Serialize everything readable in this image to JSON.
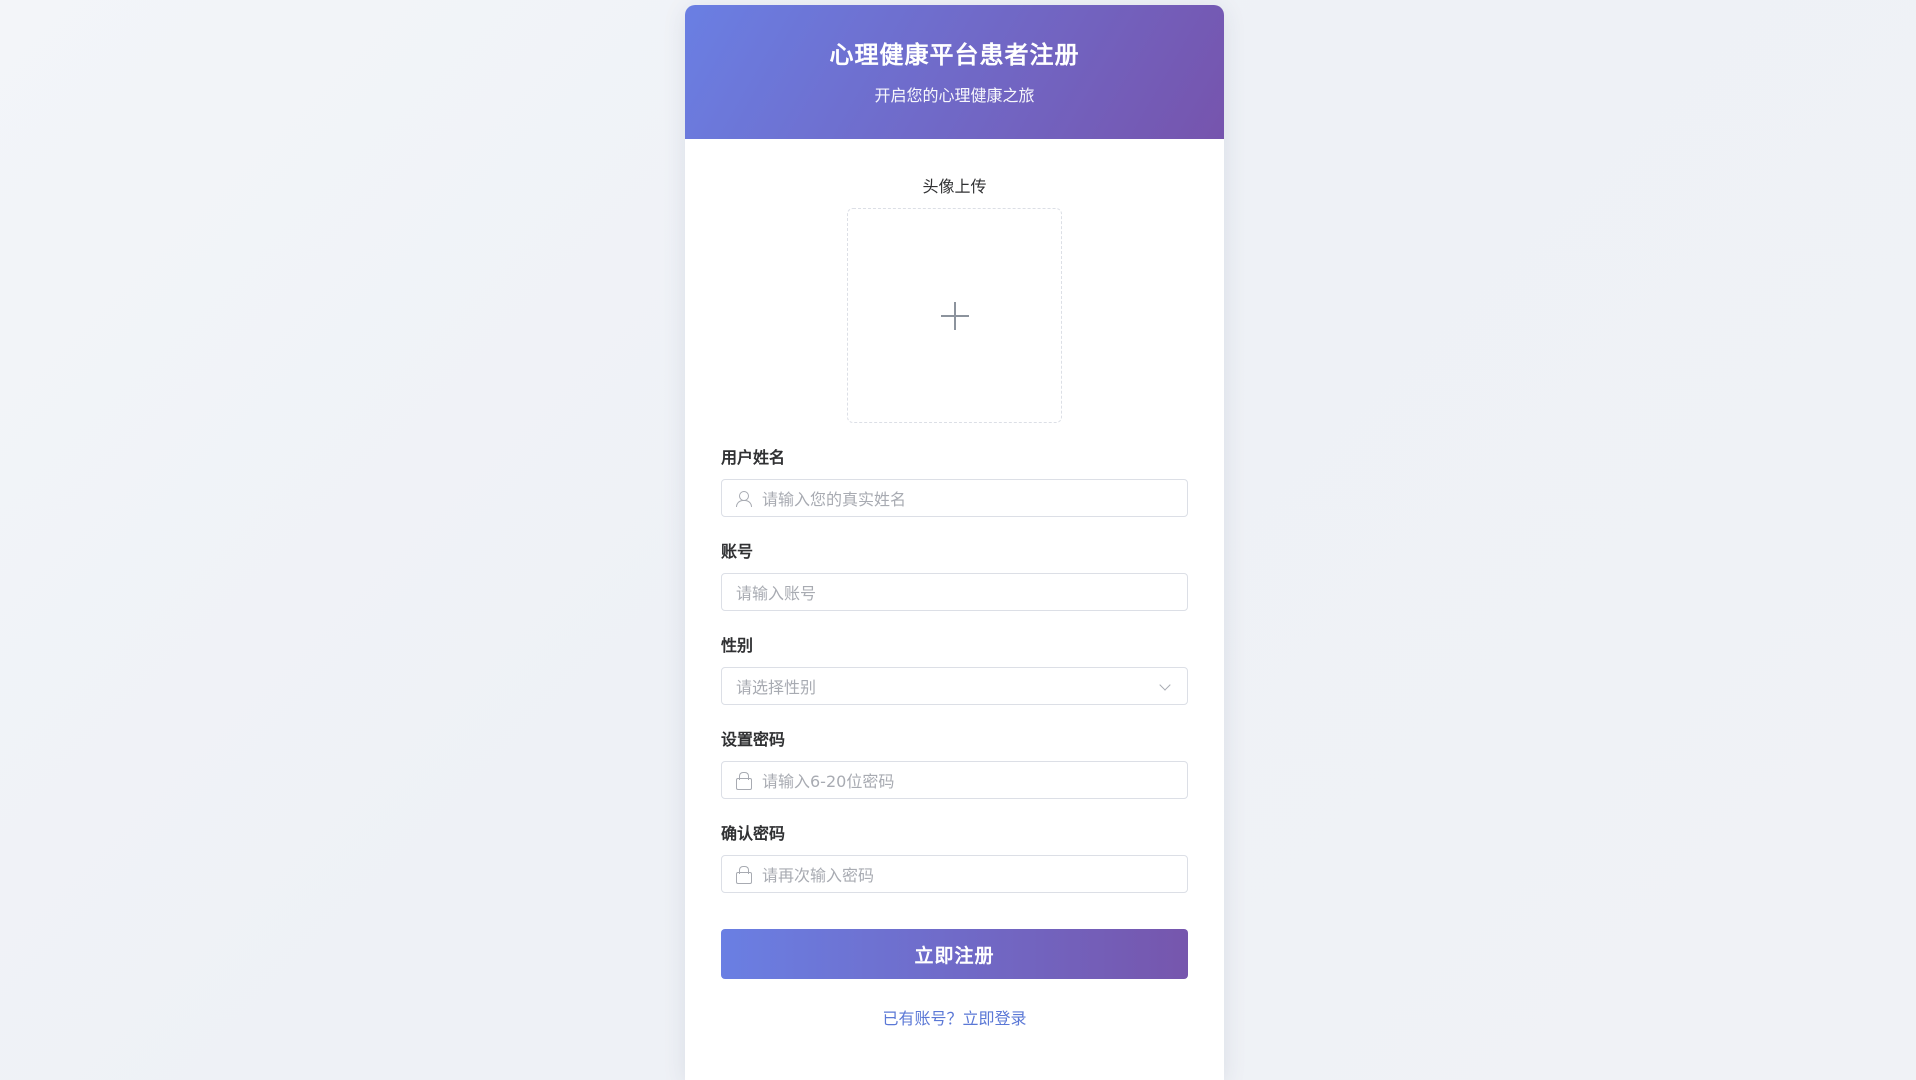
{
  "header": {
    "title": "心理健康平台患者注册",
    "subtitle": "开启您的心理健康之旅"
  },
  "avatar": {
    "label": "头像上传",
    "icon": "plus-icon"
  },
  "form": {
    "name": {
      "label": "用户姓名",
      "placeholder": "请输入您的真实姓名",
      "icon": "user-icon"
    },
    "account": {
      "label": "账号",
      "placeholder": "请输入账号"
    },
    "gender": {
      "label": "性别",
      "placeholder": "请选择性别",
      "icon": "chevron-down-icon"
    },
    "password": {
      "label": "设置密码",
      "placeholder": "请输入6-20位密码",
      "icon": "lock-icon"
    },
    "confirm": {
      "label": "确认密码",
      "placeholder": "请再次输入密码",
      "icon": "lock-icon"
    }
  },
  "actions": {
    "submit_label": "立即注册",
    "login_link": "已有账号？立即登录"
  },
  "colors": {
    "header_gradient_start": "#6a7fe3",
    "header_gradient_end": "#7654ad",
    "link": "#5b78d6"
  }
}
